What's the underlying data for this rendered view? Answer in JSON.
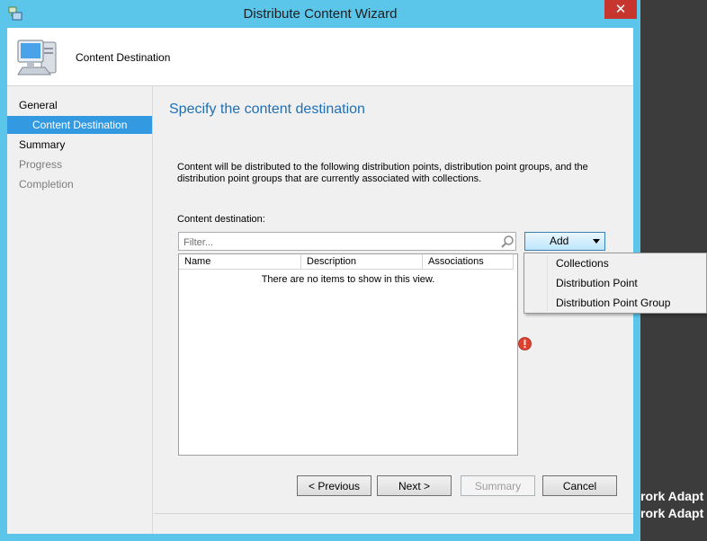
{
  "window": {
    "title": "Distribute Content Wizard",
    "close_label": "✕",
    "accent_color": "#5bc5ea"
  },
  "header": {
    "title": "Content Destination",
    "icon": "computer-icon"
  },
  "nav": {
    "items": [
      {
        "label": "General",
        "state": "normal"
      },
      {
        "label": "Content Destination",
        "state": "active"
      },
      {
        "label": "Summary",
        "state": "normal"
      },
      {
        "label": "Progress",
        "state": "disabled"
      },
      {
        "label": "Completion",
        "state": "disabled"
      }
    ]
  },
  "main": {
    "heading": "Specify the content destination",
    "description": "Content will be distributed to the following distribution points, distribution point groups, and the distribution point groups that are currently associated with collections.",
    "destination_label": "Content destination:",
    "filter_placeholder": "Filter...",
    "columns": [
      "Name",
      "Description",
      "Associations"
    ],
    "empty_message": "There are no items to show in this view.",
    "add_label": "Add"
  },
  "add_menu": {
    "items": [
      "Collections",
      "Distribution Point",
      "Distribution Point Group"
    ]
  },
  "buttons": {
    "previous": "< Previous",
    "next": "Next >",
    "summary": "Summary",
    "cancel": "Cancel"
  },
  "desktop": {
    "lines": [
      "rork Adapt",
      "rork Adapt"
    ]
  }
}
